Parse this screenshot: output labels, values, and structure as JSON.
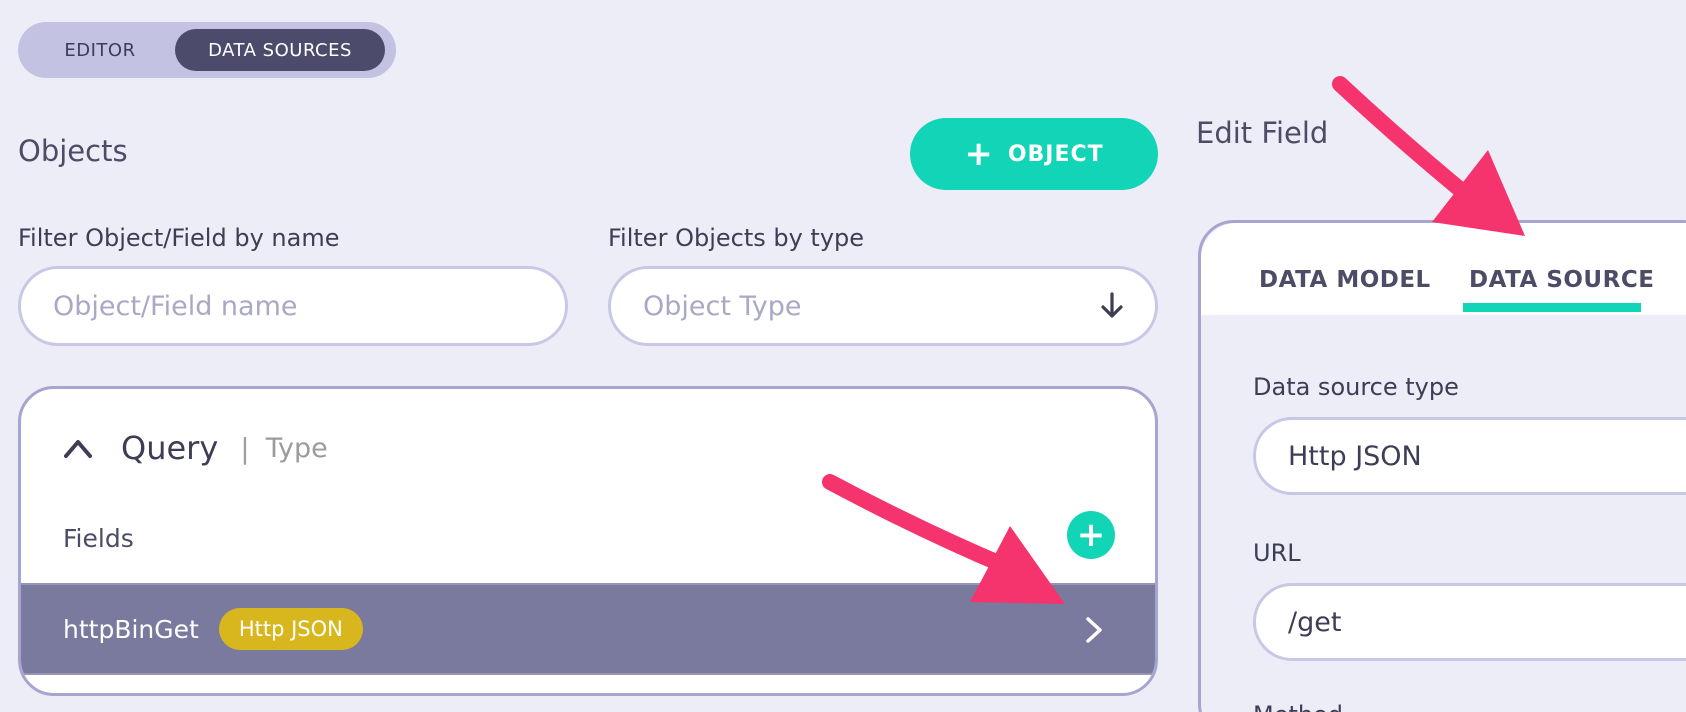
{
  "toggle": {
    "editor_label": "EDITOR",
    "data_sources_label": "DATA SOURCES"
  },
  "objects": {
    "title": "Objects",
    "add_button_label": "OBJECT"
  },
  "filters": {
    "name_label": "Filter Object/Field by name",
    "name_placeholder": "Object/Field name",
    "type_label": "Filter Objects by type",
    "type_placeholder": "Object Type"
  },
  "query": {
    "name": "Query",
    "separator": "|",
    "type_label": "Type",
    "fields_label": "Fields",
    "field": {
      "name": "httpBinGet",
      "badge": "Http JSON"
    }
  },
  "edit_field": {
    "title": "Edit Field",
    "tabs": [
      {
        "label": "DATA MODEL"
      },
      {
        "label": "DATA SOURCE"
      }
    ],
    "active_tab": "DATA SOURCE",
    "data_source_type_label": "Data source type",
    "data_source_type_value": "Http JSON",
    "url_label": "URL",
    "url_value": "/get",
    "method_label": "Method"
  },
  "colors": {
    "background": "#ededf7",
    "accent": "#12d4b6",
    "toggle_active": "#4c4b6c",
    "selected_row": "#7a799e",
    "badge": "#d8b71e",
    "annotation_arrow": "#f5336d"
  },
  "icons": {
    "add_object": "plus-icon",
    "type_dropdown": "arrow-down-icon",
    "collapse": "chevron-up-icon",
    "add_field": "plus-icon",
    "open_field": "chevron-right-icon"
  }
}
